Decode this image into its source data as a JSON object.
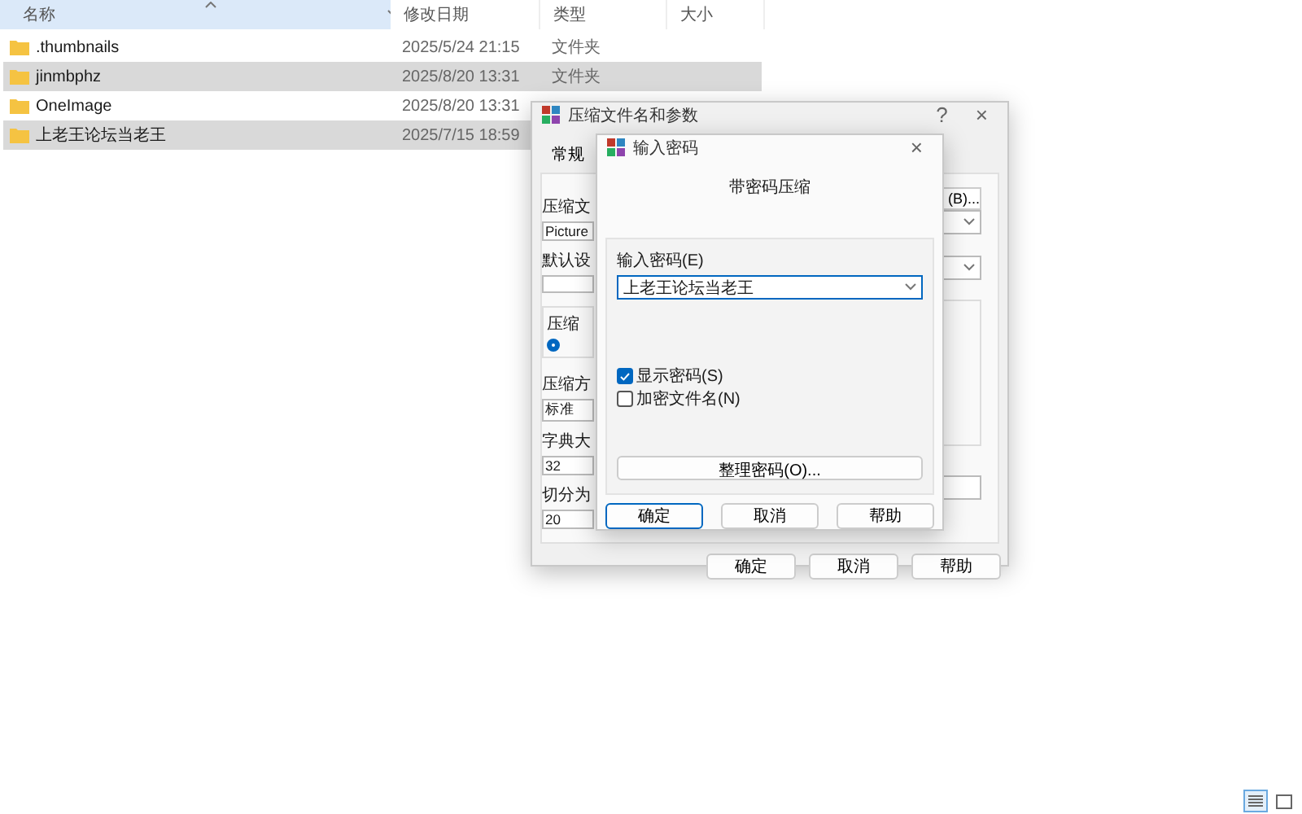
{
  "explorer": {
    "columns": [
      {
        "label": "名称",
        "sorted": true
      },
      {
        "label": "修改日期",
        "sorted": false
      },
      {
        "label": "类型",
        "sorted": false
      },
      {
        "label": "大小",
        "sorted": false
      }
    ],
    "rows": [
      {
        "name": ".thumbnails",
        "modified": "2025/5/24 21:15",
        "type": "文件夹",
        "selected": false
      },
      {
        "name": "jinmbphz",
        "modified": "2025/8/20 13:31",
        "type": "文件夹",
        "selected": true
      },
      {
        "name": "OneImage",
        "modified": "2025/8/20 13:31",
        "selected": false
      },
      {
        "name": "上老王论坛当老王",
        "modified": "2025/7/15 18:59",
        "selected": true
      }
    ],
    "views": [
      {
        "kind": "details",
        "selected": true
      },
      {
        "kind": "tiles",
        "selected": false
      }
    ]
  },
  "back_dialog": {
    "title": "压缩文件名和参数",
    "help": "?",
    "close": "×",
    "tab": "常规",
    "left": [
      {
        "kind": "label",
        "text": "压缩文"
      },
      {
        "kind": "field",
        "text": "Picture"
      },
      {
        "kind": "label",
        "text": "默认设"
      },
      {
        "kind": "field"
      },
      {
        "kind": "group",
        "text": "压缩",
        "selected": true
      },
      {
        "kind": "label",
        "text": "压缩方"
      },
      {
        "kind": "field",
        "text": "标准"
      },
      {
        "kind": "label",
        "text": "字典大"
      },
      {
        "kind": "field",
        "text": "32"
      },
      {
        "kind": "label",
        "text": "切分为"
      },
      {
        "kind": "field",
        "text": "20"
      }
    ],
    "browse_button": "(B)...",
    "buttons": [
      "确定",
      "取消",
      "帮助"
    ]
  },
  "password_dialog": {
    "title": "输入密码",
    "close": "×",
    "heading": "带密码压缩",
    "field_label": "输入密码(E)",
    "password": "上老王论坛当老王",
    "options": [
      {
        "label": "显示密码(S)",
        "checked": true
      },
      {
        "label": "加密文件名(N)",
        "checked": false
      }
    ],
    "organize_button": "整理密码(O)...",
    "buttons": [
      {
        "label": "确定",
        "focused": true
      },
      {
        "label": "取消",
        "focused": false
      },
      {
        "label": "帮助",
        "focused": false
      }
    ]
  }
}
